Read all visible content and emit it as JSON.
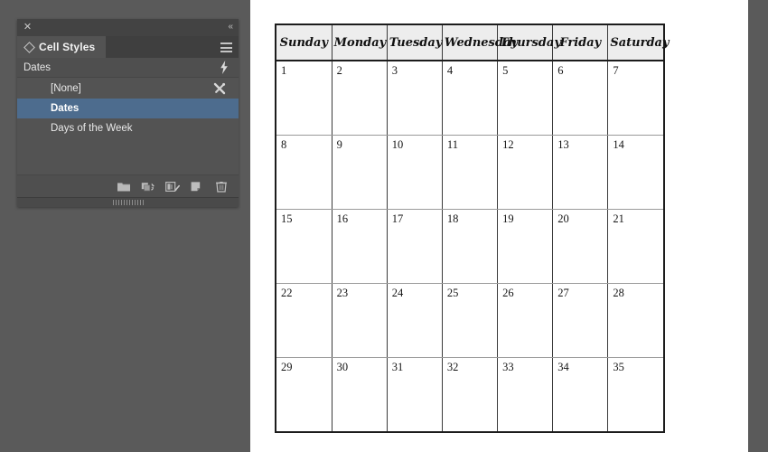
{
  "panel": {
    "close_icon": "close-icon",
    "collapse_icon": "double-chevron-left-icon",
    "tab_label": "Cell Styles",
    "menu_icon": "panel-menu-icon",
    "group_label": "Dates",
    "bolt_icon": "quick-apply-bolt-icon",
    "nostyle_icon": "clear-style-overrides-icon",
    "items": [
      {
        "label": "[None]",
        "selected": false
      },
      {
        "label": "Dates",
        "selected": true
      },
      {
        "label": "Days of the Week",
        "selected": false
      }
    ],
    "toolbar": [
      {
        "name": "new-style-group-button",
        "icon": "folder-icon"
      },
      {
        "name": "load-cell-styles-button",
        "icon": "duplicate-arrow-icon"
      },
      {
        "name": "clear-overrides-button",
        "icon": "clear-attributes-icon"
      },
      {
        "name": "create-new-style-button",
        "icon": "new-page-icon"
      },
      {
        "name": "delete-style-button",
        "icon": "trash-icon"
      }
    ],
    "resize_grip": "resize-grip"
  },
  "calendar": {
    "day_headers": [
      "Sunday",
      "Monday",
      "Tuesday",
      "Wednesday",
      "Thursday",
      "Friday",
      "Saturday"
    ],
    "weeks": [
      [
        "1",
        "2",
        "3",
        "4",
        "5",
        "6",
        "7"
      ],
      [
        "8",
        "9",
        "10",
        "11",
        "12",
        "13",
        "14"
      ],
      [
        "15",
        "16",
        "17",
        "18",
        "19",
        "20",
        "21"
      ],
      [
        "22",
        "23",
        "24",
        "25",
        "26",
        "27",
        "28"
      ],
      [
        "29",
        "30",
        "31",
        "32",
        "33",
        "34",
        "35"
      ]
    ]
  },
  "colors": {
    "app_background": "#5a5a5a",
    "panel_background": "#535353",
    "panel_titlebar": "#434343",
    "selection_blue": "#4d6c8e",
    "header_fill": "#ededed",
    "table_border": "#1c1c1c"
  }
}
